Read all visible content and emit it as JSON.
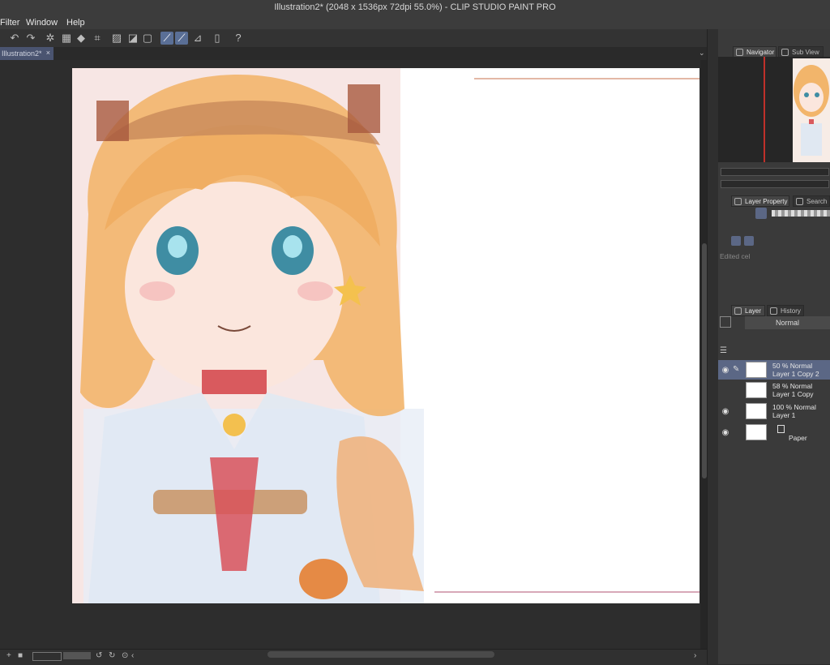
{
  "window": {
    "title": "Illustration2* (2048 x 1536px 72dpi 55.0%)  - CLIP STUDIO PAINT PRO"
  },
  "menu": {
    "items": [
      "Filter",
      "Window",
      "Help"
    ]
  },
  "tab": {
    "label": "Illustration2*",
    "close": "×"
  },
  "toolbar": {
    "icons": [
      "undo-icon",
      "redo-icon",
      "clear-icon",
      "fill-selection-icon",
      "fill-icon",
      "crop-icon",
      "transform-icon",
      "snap-ruler-icon",
      "snap-special-ruler-icon",
      "snap-grid-icon",
      "pen-pressure-icon",
      "device-icon",
      "help-icon"
    ]
  },
  "panels": {
    "navigator_tab": "Navigator",
    "subview_tab": "Sub View",
    "layer_property_tab": "Layer Property",
    "search_tab": "Search",
    "edited_cel": "Edited cel",
    "layer_tab": "Layer",
    "history_tab": "History",
    "blend_mode": "Normal"
  },
  "layers": [
    {
      "line1": "50 % Normal",
      "line2": "Layer 1 Copy 2",
      "selected": true,
      "visible": true
    },
    {
      "line1": "58 % Normal",
      "line2": "Layer 1 Copy",
      "selected": false,
      "visible": false
    },
    {
      "line1": "100 % Normal",
      "line2": "Layer 1",
      "selected": false,
      "visible": true
    },
    {
      "line1": "",
      "line2": "Paper",
      "selected": false,
      "visible": true
    }
  ],
  "colors": {
    "accent": "#5b6785",
    "canvas_bg": "#2d2d2d",
    "panel_bg": "#3a3a3a"
  }
}
